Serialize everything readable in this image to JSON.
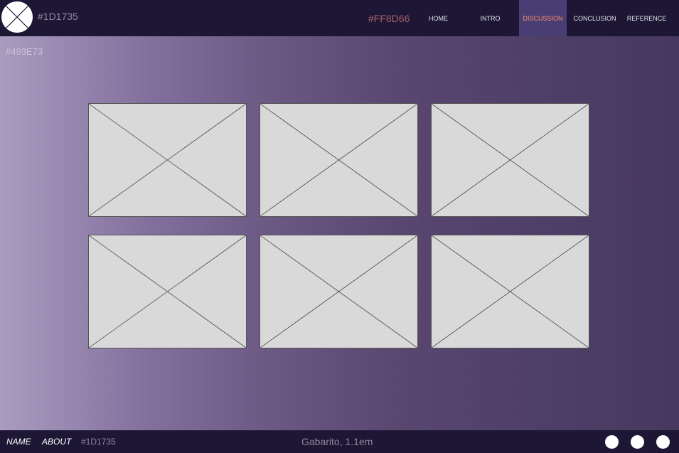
{
  "header": {
    "color_label": "#1D1735",
    "accent_label": "#FF8D66",
    "nav": [
      {
        "label": "HOME",
        "active": false
      },
      {
        "label": "INTRO",
        "active": false
      },
      {
        "label": "DISCUSSION",
        "active": true
      },
      {
        "label": "CONCLUSION",
        "active": false
      },
      {
        "label": "REFERENCE",
        "active": false
      }
    ]
  },
  "main": {
    "color_label": "#493E73",
    "placeholders": 6
  },
  "footer": {
    "name_link": "NAME",
    "about_link": "ABOUT",
    "color_label": "#1D1735",
    "font_note": "Gabarito, 1.1em"
  },
  "colors": {
    "header_bg": "#1D1735",
    "accent": "#FF8D66",
    "active_tab_bg": "#493E73",
    "placeholder_fill": "#D9D9D9"
  }
}
